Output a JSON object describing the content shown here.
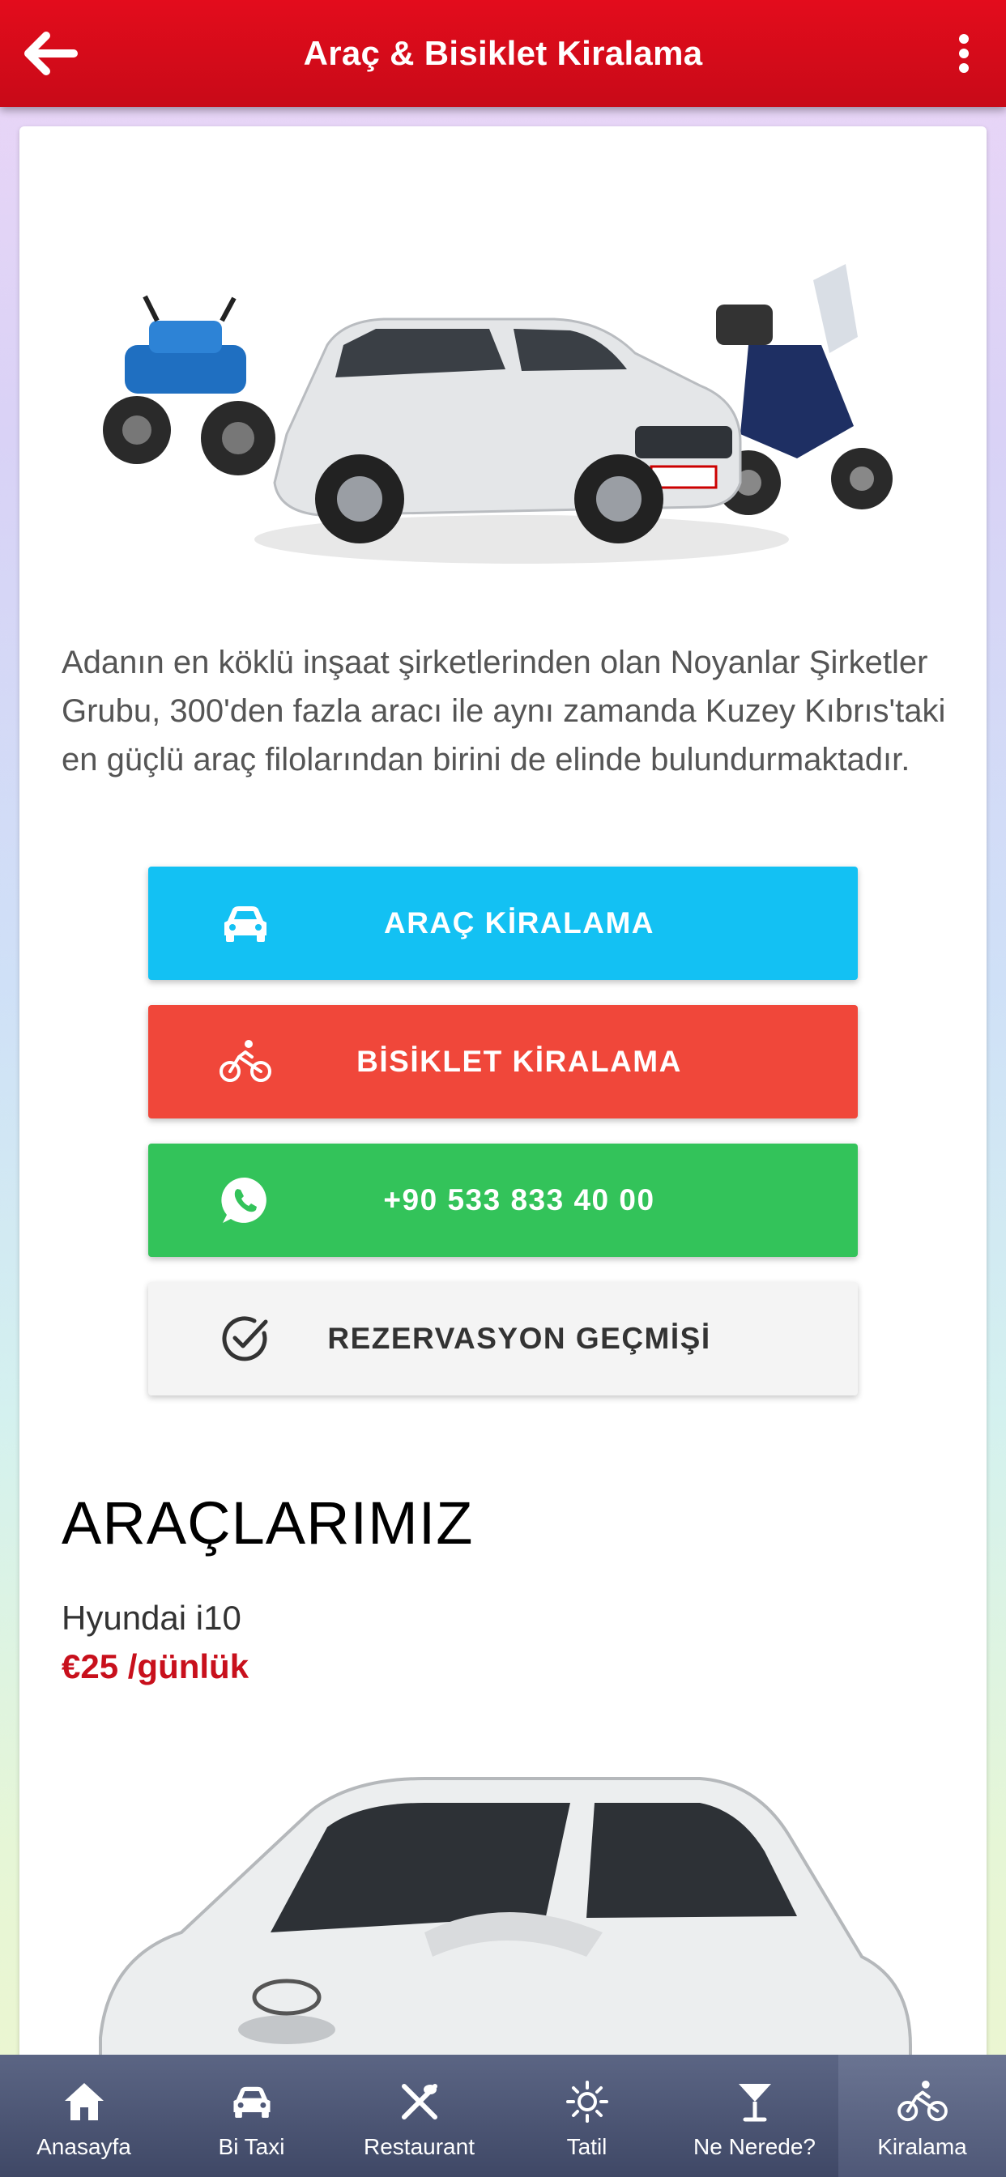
{
  "header": {
    "title": "Araç & Bisiklet Kiralama",
    "back_icon": "arrow-left-icon",
    "menu_icon": "more-vertical-icon"
  },
  "intro": {
    "text": "Adanın en köklü inşaat şirketlerinden olan Noyanlar Şirketler Grubu, 300'den fazla aracı ile aynı zamanda Kuzey Kıbrıs'taki en güçlü araç filolarından birini de elinde bulundurmaktadır."
  },
  "buttons": {
    "car_rental": {
      "label": "ARAÇ KİRALAMA",
      "icon": "car-icon",
      "color": "#13c1f3"
    },
    "bike_rental": {
      "label": "BİSİKLET KİRALAMA",
      "icon": "bicycle-icon",
      "color": "#f0473a"
    },
    "whatsapp": {
      "label": "+90 533 833 40 00",
      "icon": "whatsapp-icon",
      "color": "#33c35a"
    },
    "history": {
      "label": "REZERVASYON GEÇMİŞİ",
      "icon": "check-circle-icon",
      "color": "#f4f4f4"
    }
  },
  "vehicles": {
    "section_title": "ARAÇLARIMIZ",
    "items": [
      {
        "name": "Hyundai i10",
        "price": "€25 /günlük"
      }
    ]
  },
  "bottom_nav": [
    {
      "label": "Anasayfa",
      "icon": "home-icon",
      "active": false
    },
    {
      "label": "Bi Taxi",
      "icon": "car-icon",
      "active": false
    },
    {
      "label": "Restaurant",
      "icon": "cutlery-icon",
      "active": false
    },
    {
      "label": "Tatil",
      "icon": "sun-icon",
      "active": false
    },
    {
      "label": "Ne Nerede?",
      "icon": "cocktail-icon",
      "active": false
    },
    {
      "label": "Kiralama",
      "icon": "bicycle-icon",
      "active": true
    }
  ],
  "colors": {
    "header": "#e30c1c",
    "price": "#c8101c",
    "nav": "#4f5877"
  }
}
